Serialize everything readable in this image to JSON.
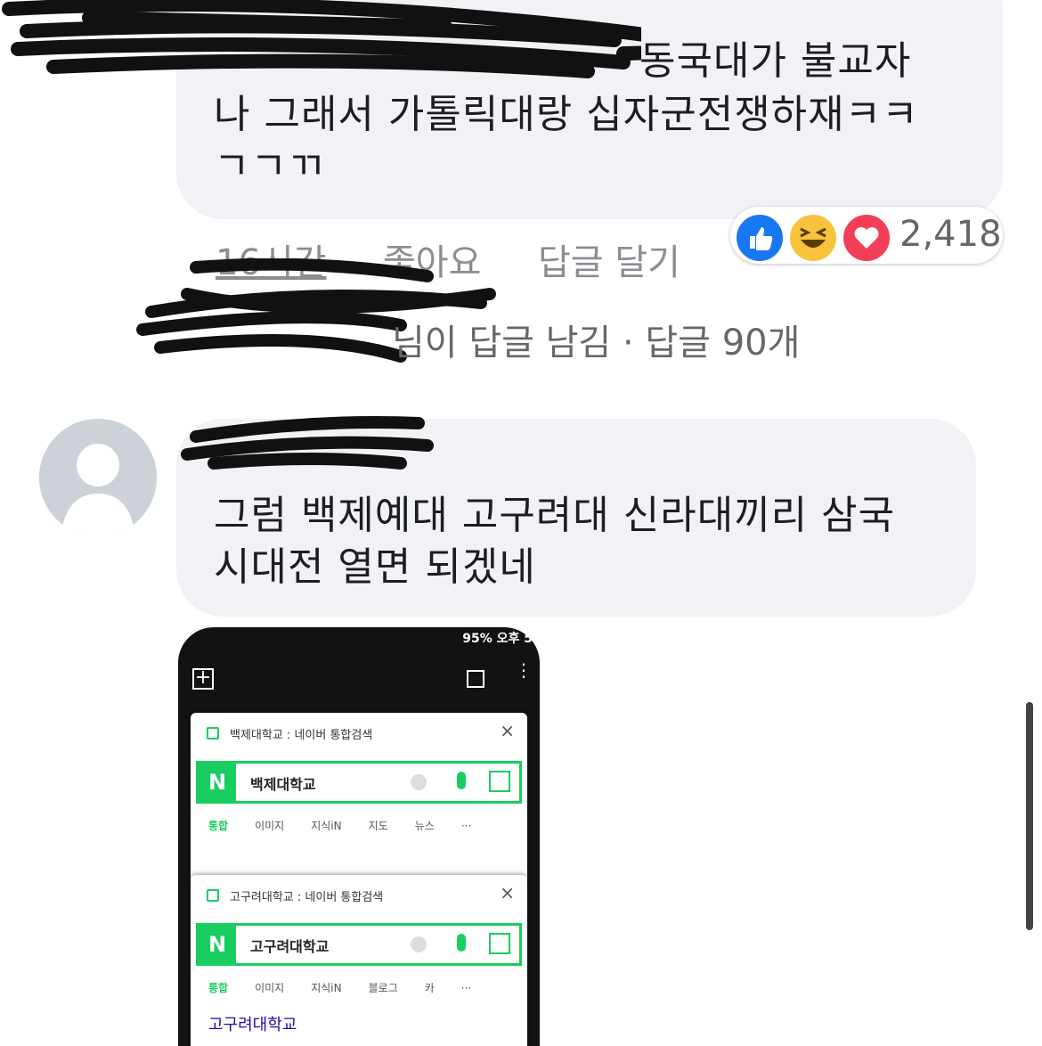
{
  "comment1": {
    "text_line1": "동국대가 불교자",
    "text_line2": "나 그래서 가톨릭대랑 십자군전쟁하재ㅋㅋ",
    "text_line3": "ㄱㄱㄲ",
    "time": "16시간",
    "like_label": "좋아요",
    "reply_label": "답글 달기",
    "reaction_count": "2,418",
    "reactions": [
      "like-icon",
      "haha-icon",
      "love-icon"
    ]
  },
  "replies_summary": {
    "text": "님이 답글 남김 · 답글 90개"
  },
  "comment2": {
    "text": "그럼 백제예대 고구려대 신라대끼리 삼국\n시대전 열면 되겠네"
  },
  "phone": {
    "status_bar": "95% 오후 5",
    "cards": [
      {
        "tab_title": "백제대학교 : 네이버 통합검색",
        "search_value": "백제대학교",
        "tabs": [
          "통합",
          "이미지",
          "지식iN",
          "지도",
          "뉴스",
          "···"
        ]
      },
      {
        "tab_title": "고구려대학교 : 네이버 통합검색",
        "search_value": "고구려대학교",
        "tabs": [
          "통합",
          "이미지",
          "지식iN",
          "블로그",
          "카",
          "···"
        ],
        "result_title": "고구려대학교"
      }
    ],
    "logo_letter": "N"
  },
  "colors": {
    "bubble": "#f0f2f5",
    "meta": "#8a8d91",
    "like_blue": "#1877f2",
    "haha_yellow": "#f7c23c",
    "love_red": "#f33e58",
    "naver_green": "#19ce60"
  }
}
